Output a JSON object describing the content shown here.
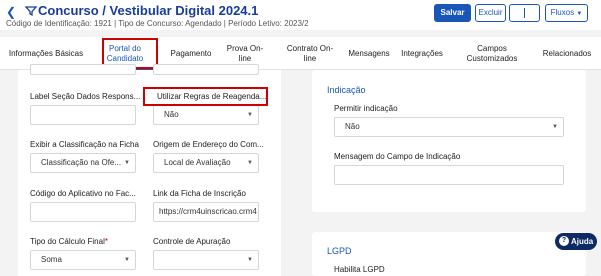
{
  "header": {
    "title": "Concurso",
    "title_suffix": "/ Vestibular Digital 2024.1",
    "subtitle": "Código de Identificação: 1921 | Tipo de Concurso: Agendado | Período Letivo: 2023/2",
    "buttons": {
      "save": "Salvar",
      "delete": "Excluir",
      "flows": "Fluxos"
    }
  },
  "tabs": [
    {
      "label": "Informações Básicas"
    },
    {
      "label": "Portal do Candidato"
    },
    {
      "label": "Pagamento"
    },
    {
      "label": "Prova On-line"
    },
    {
      "label": "Contrato On-line"
    },
    {
      "label": "Mensagens"
    },
    {
      "label": "Integrações"
    },
    {
      "label": "Campos Customizados"
    },
    {
      "label": "Relacionados"
    }
  ],
  "left_form": {
    "label_secao": {
      "label": "Label Seção Dados Respons...",
      "value": ""
    },
    "regras_reagendamento": {
      "label": "Utilizar Regras de Reagenda...",
      "value": "Não"
    },
    "exibir_classificacao": {
      "label": "Exibir a Classificação na Ficha",
      "value": "Classificação na Ofe..."
    },
    "origem_endereco": {
      "label": "Origem de Endereço do Com...",
      "value": "Local de Avaliação"
    },
    "codigo_aplicativo": {
      "label": "Código do Aplicativo no Fac...",
      "value": ""
    },
    "link_ficha": {
      "label": "Link da Ficha de Inscrição",
      "value": "https://crm4uinscricao.crm4"
    },
    "tipo_calculo": {
      "label": "Tipo do Cálculo Final",
      "required": "*",
      "value": "Soma"
    },
    "controle_apuracao": {
      "label": "Controle de Apuração",
      "value": ""
    }
  },
  "indicacao": {
    "title": "Indicação",
    "permitir_label": "Permitir indicação",
    "permitir_value": "Não",
    "mensagem_label": "Mensagem do Campo de Indicação",
    "mensagem_value": ""
  },
  "lgpd": {
    "title": "LGPD",
    "habilita_label": "Habilita LGPD"
  },
  "help": {
    "label": "Ajuda"
  },
  "colors": {
    "accent": "#1a56b8",
    "highlight": "#d10000",
    "help_bg": "#0e2a66"
  },
  "icons": [
    "chevron-left-icon",
    "filter-icon",
    "chevron-down-icon",
    "help-icon"
  ]
}
